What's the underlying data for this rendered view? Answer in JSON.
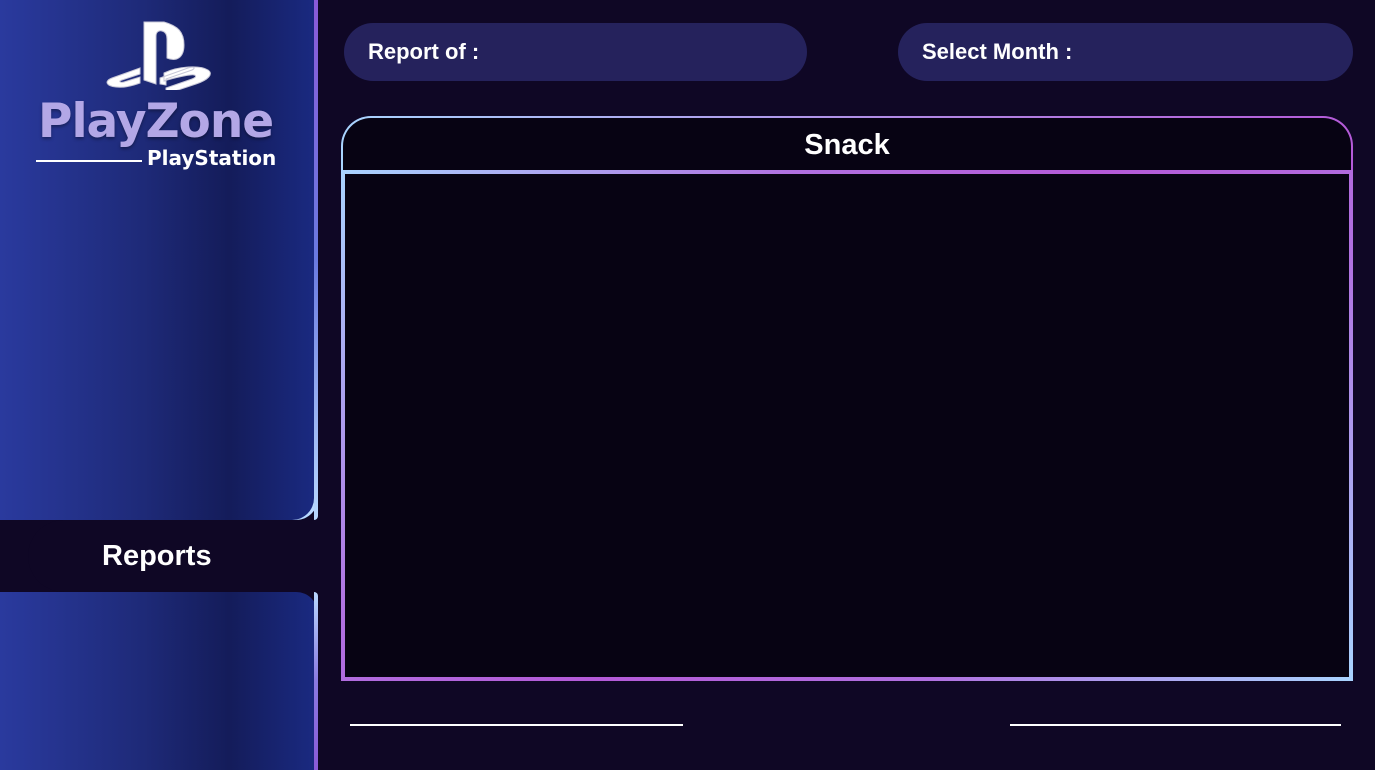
{
  "brand": {
    "icon": "playstation-logo-icon",
    "title": "PlayZone",
    "subtitle": "PlayStation"
  },
  "sidebar": {
    "items": [
      {
        "label": "Reports",
        "active": true
      }
    ]
  },
  "header": {
    "report_label": "Report of :",
    "month_label": "Select Month :"
  },
  "panel": {
    "title": "Snack"
  },
  "colors": {
    "background": "#0f0725",
    "sidebar_gradient_start": "#2a3a9e",
    "sidebar_gradient_end": "#141c5a",
    "pill": "#25225c",
    "panel_fill": "#070313",
    "accent_blue": "#a9d4ff",
    "accent_purple": "#b45ad8"
  }
}
